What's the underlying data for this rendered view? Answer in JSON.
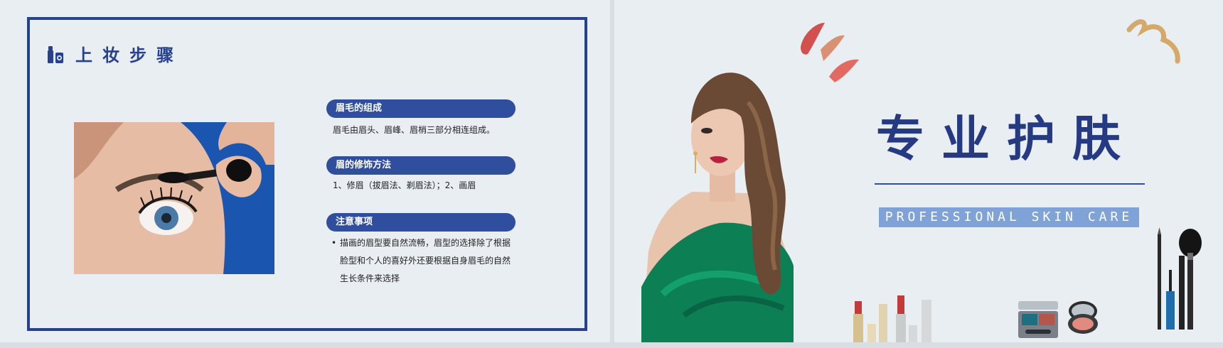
{
  "left_slide": {
    "title": "上妆步骤",
    "sections": [
      {
        "heading": "眉毛的组成",
        "body": "眉毛由眉头、眉峰、眉梢三部分相连组成。"
      },
      {
        "heading": "眉的修饰方法",
        "body": "1、修眉（拔眉法、剃眉法）；2、画眉"
      },
      {
        "heading": "注意事项",
        "bullet_lines": [
          "描画的眉型要自然流畅，眉型的选择除了根据",
          "脸型和个人的喜好外还要根据自身眉毛的自然",
          "生长条件来选择"
        ]
      }
    ]
  },
  "right_slide": {
    "title": "专业护肤",
    "subtitle": "PROFESSIONAL SKIN CARE"
  },
  "colors": {
    "primary": "#26418f",
    "pill": "#2f4e9e",
    "subtitle_bg": "#7fa3d6",
    "background": "#e8eef2"
  },
  "icons": [
    "makeup-tools-icon",
    "lipstick-set-icon",
    "eyeshadow-palette-icon",
    "compact-mirror-icon",
    "brush-set-icon",
    "lipstick-swatch-icon",
    "ribbon-icon"
  ]
}
